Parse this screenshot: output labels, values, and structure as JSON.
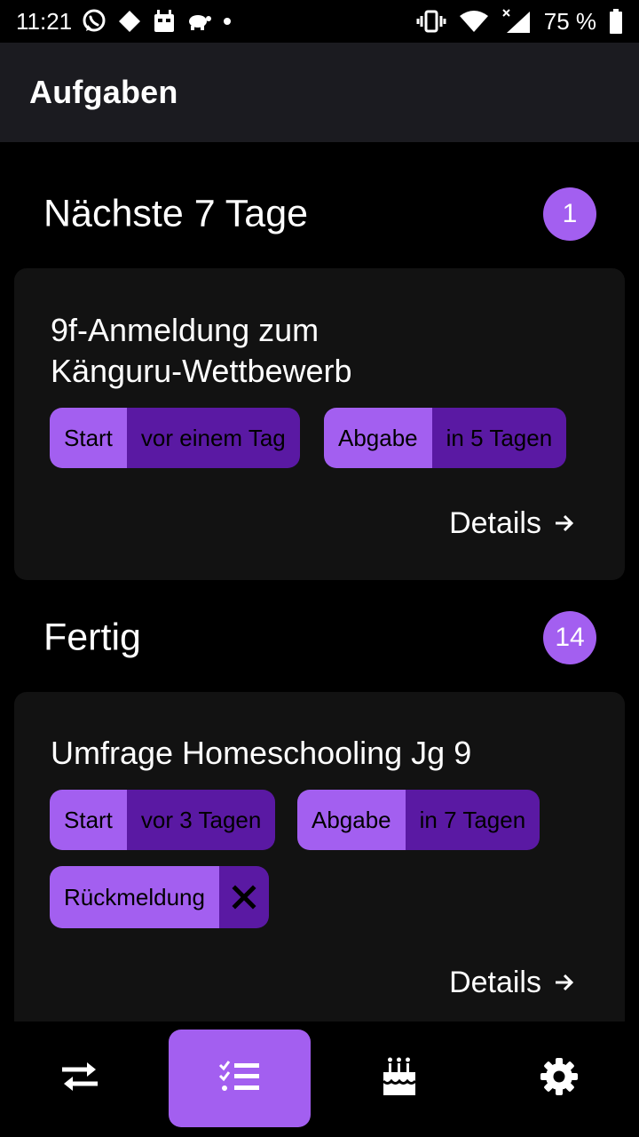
{
  "status_bar": {
    "time": "11:21",
    "battery": "75 %",
    "left_icons": [
      "whatsapp-icon",
      "diamond-icon",
      "robot-icon",
      "turtle-icon",
      "dot-icon"
    ],
    "right_icons": [
      "vibrate-icon",
      "wifi-icon",
      "signal-icon",
      "battery-icon"
    ]
  },
  "app_bar": {
    "title": "Aufgaben"
  },
  "sections": [
    {
      "title": "Nächste 7 Tage",
      "count": "1",
      "cards": [
        {
          "title_line1": "9f-Anmeldung zum",
          "title_line2": "Känguru-Wettbewerb",
          "start_label": "Start",
          "start_value": "vor einem Tag",
          "due_label": "Abgabe",
          "due_value": "in 5 Tagen",
          "details_label": "Details"
        }
      ]
    },
    {
      "title": "Fertig",
      "count": "14",
      "cards": [
        {
          "title_line1": "Umfrage Homeschooling Jg 9",
          "start_label": "Start",
          "start_value": "vor 3 Tagen",
          "due_label": "Abgabe",
          "due_value": "in 7 Tagen",
          "feedback_label": "Rückmeldung",
          "feedback_icon": "close-icon",
          "details_label": "Details"
        }
      ]
    }
  ],
  "bottom_nav": {
    "active_index": 1,
    "items": [
      "swap-icon",
      "task-list-icon",
      "birthday-cake-icon",
      "gear-icon"
    ]
  },
  "colors": {
    "accent": "#a35ff0",
    "accent_dark": "#5a19a3",
    "card_bg": "#121212",
    "app_bar_bg": "#1b1b20"
  }
}
